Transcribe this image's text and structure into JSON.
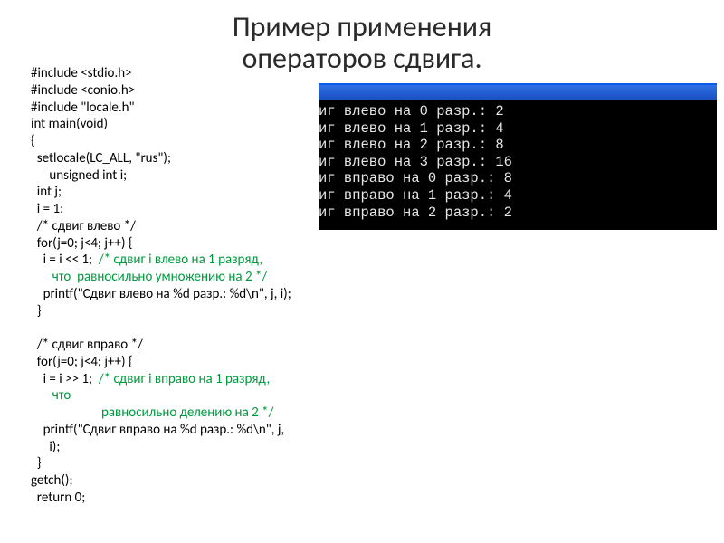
{
  "title": {
    "line1": "Пример применения",
    "line2": "операторов сдвига."
  },
  "code": {
    "l1": "#include <stdio.h>",
    "l2": "#include <conio.h>",
    "l3": "#include \"locale.h\"",
    "l4": "int main(void)",
    "l5": "{",
    "l6": "  setlocale(LC_ALL, \"rus\");",
    "l7": "      unsigned int i;",
    "l8": "  int j;",
    "l9": "  i = 1;",
    "l10": "  /* сдвиг влево */",
    "l11": "  for(j=0; j<4; j++) {",
    "l12a": "    i = i << 1;  ",
    "l12b": "/* сдвиг i влево на 1 разряд,",
    "l12c": "       что  равносильно умножению на 2 */",
    "l13": "    printf(\"Сдвиг влево на %d разр.: %d\\n\", j, i);",
    "l14": "  }",
    "l15": "",
    "l16": "  /* сдвиг вправо */",
    "l17": "  for(j=0; j<4; j++) {",
    "l18a": "    i = i >> 1;  ",
    "l18b": "/* сдвиг i вправо на 1 разряд,",
    "l18c": "       что",
    "l18d": "                       равносильно делению на 2 */",
    "l19": "    printf(\"Сдвиг вправо на %d разр.: %d\\n\", j,",
    "l19b": "      i);",
    "l20": "  }",
    "l21": "getch();",
    "l22": "  return 0;"
  },
  "console": {
    "lines": [
      "иг влево на 0 разр.: 2",
      "иг влево на 1 разр.: 4",
      "иг влево на 2 разр.: 8",
      "иг влево на 3 разр.: 16",
      "иг вправо на 0 разр.: 8",
      "иг вправо на 1 разр.: 4",
      "иг вправо на 2 разр.: 2"
    ]
  }
}
